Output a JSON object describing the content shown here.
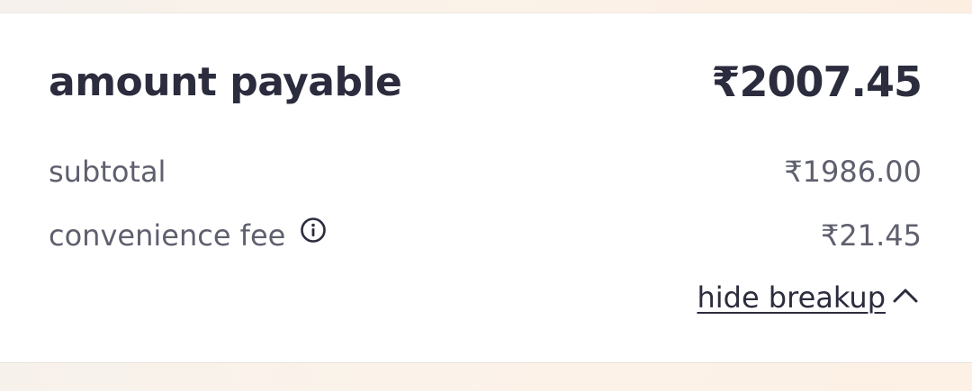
{
  "summary": {
    "total_label": "amount payable",
    "total_value": "₹2007.45"
  },
  "lines": {
    "subtotal_label": "subtotal",
    "subtotal_value": "₹1986.00",
    "fee_label": "convenience fee",
    "fee_value": "₹21.45"
  },
  "actions": {
    "toggle_label": "hide breakup",
    "toggle_icon": "chevron-up-icon",
    "info_icon": "info-icon"
  },
  "colors": {
    "text_primary": "#2b2c3d",
    "text_secondary": "#5f606e",
    "card_bg": "#ffffff"
  }
}
